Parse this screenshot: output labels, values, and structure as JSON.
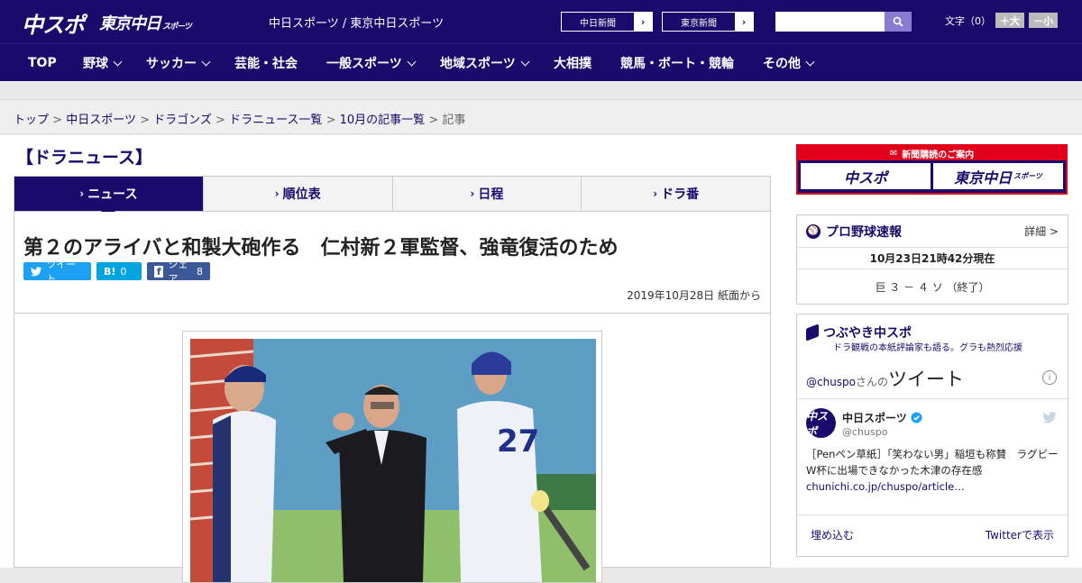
{
  "header": {
    "logo_main": "中スポ",
    "logo_tokyo": "東京中日",
    "logo_tokyo_sub": "スポーツ",
    "site_title": "中日スポーツ / 東京中日スポーツ",
    "buttons": [
      {
        "label": "中日新聞"
      },
      {
        "label": "東京新聞"
      }
    ],
    "search": {
      "placeholder": "",
      "value": ""
    },
    "font_size": {
      "label": "文字（0）",
      "increase": "＋大",
      "decrease": "－小"
    }
  },
  "nav": {
    "items": [
      {
        "label": "TOP",
        "has_dropdown": false
      },
      {
        "label": "野球",
        "has_dropdown": true
      },
      {
        "label": "サッカー",
        "has_dropdown": true
      },
      {
        "label": "芸能・社会",
        "has_dropdown": false
      },
      {
        "label": "一般スポーツ",
        "has_dropdown": true
      },
      {
        "label": "地域スポーツ",
        "has_dropdown": true
      },
      {
        "label": "大相撲",
        "has_dropdown": false
      },
      {
        "label": "競馬・ボート・競輪",
        "has_dropdown": false
      },
      {
        "label": "その他",
        "has_dropdown": true
      }
    ]
  },
  "breadcrumb": {
    "items": [
      "トップ",
      "中日スポーツ",
      "ドラゴンズ",
      "ドラニュース一覧",
      "10月の記事一覧"
    ],
    "current": "記事",
    "separator": ">"
  },
  "section_title": "【ドラニュース】",
  "tabs": [
    {
      "label": "ニュース",
      "active": true
    },
    {
      "label": "順位表",
      "active": false
    },
    {
      "label": "日程",
      "active": false
    },
    {
      "label": "ドラ番",
      "active": false
    }
  ],
  "article": {
    "headline": "第２のアライバと和製大砲作る　仁村新２軍監督、強竜復活のため",
    "share": {
      "tweet_label": "ツイート",
      "hatena_label": "B!",
      "hatena_count": "0",
      "facebook_label": "シェア",
      "facebook_count": "8"
    },
    "date": "2019年10月28日 紙面から"
  },
  "sidebar": {
    "subscribe": {
      "header": "新聞購読のご案内",
      "logos": [
        "中スポ",
        "東京中日"
      ],
      "logo_sub": "スポーツ"
    },
    "scores": {
      "title": "プロ野球速報",
      "detail": "詳細 >",
      "time": "10月23日21時42分現在",
      "game": "巨 ３ － ４ ソ （終了）"
    },
    "twitter": {
      "title": "つぶやき中スポ",
      "subtitle": "ドラ観戦の本紙評論家も語る。グラも熱烈応援",
      "handle_prefix": "@chuspo",
      "handle_suffix": "さんの",
      "tweet_label": "ツイート",
      "account_name": "中日スポーツ",
      "account_handle": "@chuspo",
      "avatar_text": "中スポ",
      "tweet_text": "［Penペン草紙］「笑わない男」稲垣も称賛　ラグビーW杯に出場できなかった木津の存在感",
      "tweet_link": "chunichi.co.jp/chuspo/article…",
      "embed_label": "埋め込む",
      "view_label": "Twitterで表示"
    }
  },
  "colors": {
    "brand_navy": "#1a0a6b",
    "accent_red": "#e0001a",
    "twitter_blue": "#1da1f2",
    "hatena_blue": "#00a4de",
    "facebook_blue": "#3b5998"
  }
}
